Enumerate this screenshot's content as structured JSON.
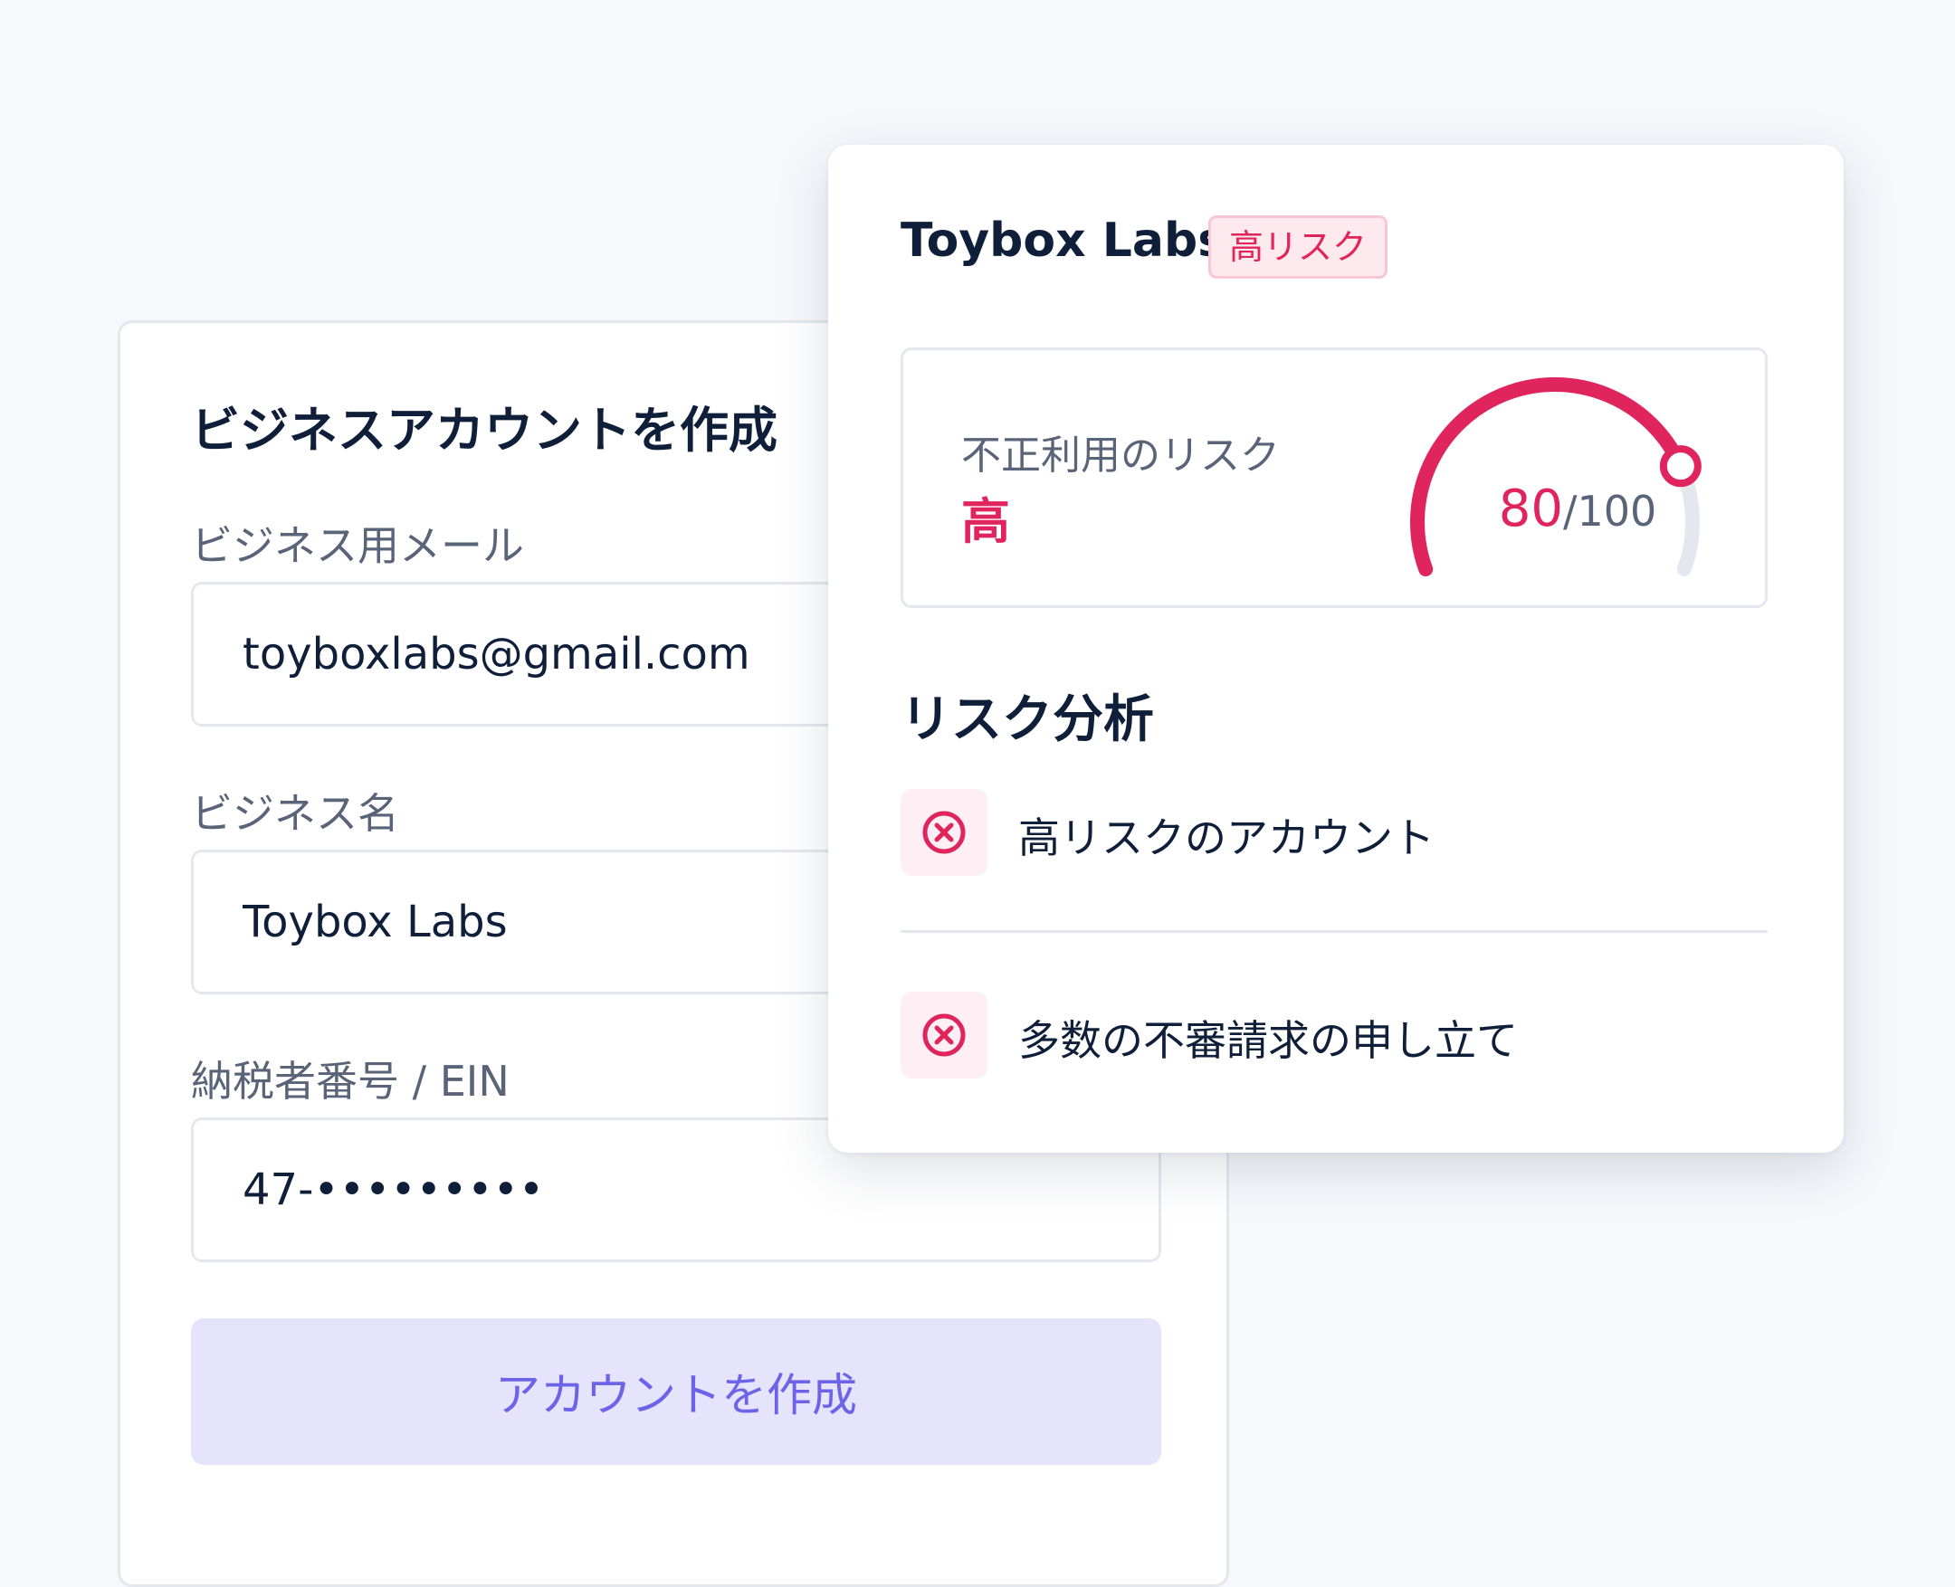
{
  "signup_form": {
    "title": "ビジネスアカウントを作成",
    "email_label": "ビジネス用メール",
    "email_value": "toyboxlabs@gmail.com",
    "business_name_label": "ビジネス名",
    "business_name_value": "Toybox Labs",
    "tax_id_label": "納税者番号 / EIN",
    "tax_id_value": "47-•••••••••",
    "submit_label": "アカウントを作成"
  },
  "risk_panel": {
    "company_name": "Toybox Labs",
    "risk_badge": "高リスク",
    "fraud_risk_label": "不正利用のリスク",
    "fraud_risk_level": "高",
    "score": "80",
    "score_max": "/100",
    "score_fraction": 0.8,
    "analysis_title": "リスク分析",
    "analysis_items": [
      {
        "icon": "x-circle-icon",
        "text": "高リスクのアカウント"
      },
      {
        "icon": "x-circle-icon",
        "text": "多数の不審請求の申し立て"
      }
    ],
    "colors": {
      "risk": "#e0245e",
      "track": "#e4e8ee",
      "badge_bg": "#fde9ee",
      "button_bg": "#e6e4fc",
      "button_text": "#6d63e8"
    }
  }
}
